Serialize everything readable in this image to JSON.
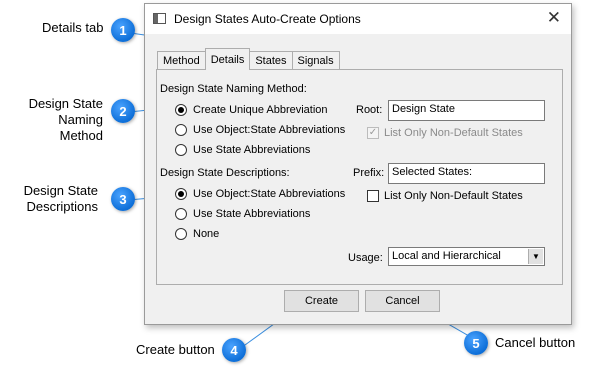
{
  "callouts": [
    {
      "num": "1",
      "text": "Details tab"
    },
    {
      "num": "2",
      "text_line1": "Design State",
      "text_line2": "Naming Method"
    },
    {
      "num": "3",
      "text_line1": "Design State",
      "text_line2": "Descriptions"
    },
    {
      "num": "4",
      "text": "Create button"
    },
    {
      "num": "5",
      "text": "Cancel button"
    }
  ],
  "window": {
    "title": "Design States Auto-Create Options",
    "close_glyph": "✕"
  },
  "tabs": [
    {
      "label": "Method",
      "active": false
    },
    {
      "label": "Details",
      "active": true
    },
    {
      "label": "States",
      "active": false
    },
    {
      "label": "Signals",
      "active": false
    }
  ],
  "naming": {
    "heading": "Design State Naming Method:",
    "options": [
      {
        "label": "Create Unique Abbreviation",
        "selected": true
      },
      {
        "label": "Use Object:State Abbreviations",
        "selected": false
      },
      {
        "label": "Use State Abbreviations",
        "selected": false
      }
    ],
    "root_label": "Root:",
    "root_value": "Design State",
    "list_non_default_label": "List Only Non-Default States",
    "list_non_default_checked": true,
    "list_non_default_enabled": false
  },
  "descriptions": {
    "heading": "Design State Descriptions:",
    "options": [
      {
        "label": "Use Object:State Abbreviations",
        "selected": true
      },
      {
        "label": "Use State Abbreviations",
        "selected": false
      },
      {
        "label": "None",
        "selected": false
      }
    ],
    "prefix_label": "Prefix:",
    "prefix_value": "Selected States:",
    "list_non_default_label": "List Only Non-Default States",
    "list_non_default_checked": false
  },
  "usage": {
    "label": "Usage:",
    "value": "Local and Hierarchical",
    "arrow": "▼"
  },
  "buttons": {
    "create": "Create",
    "cancel": "Cancel"
  },
  "colors": {
    "bubble": "#0e6fd8",
    "leader_line": "#3b8fe0",
    "dialog_bg": "#f0f0f0"
  }
}
